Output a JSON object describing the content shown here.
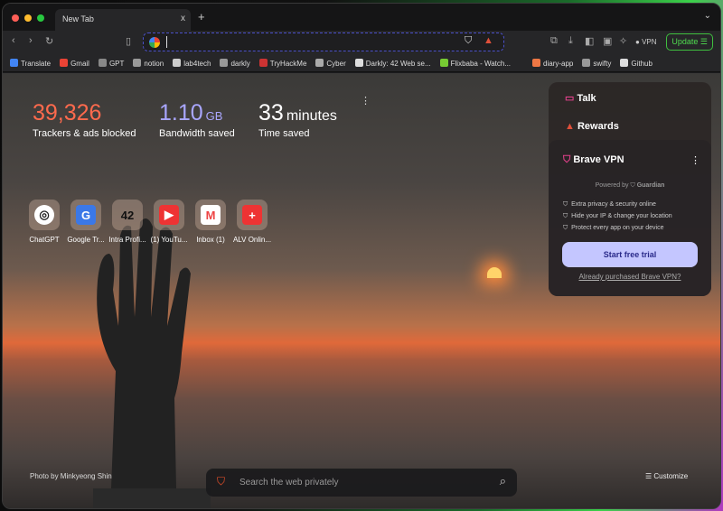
{
  "tab": {
    "title": "New Tab",
    "close": "x",
    "new": "+"
  },
  "toolbar": {
    "vpn": "VPN",
    "update": "Update"
  },
  "bookmarks": [
    "Translate",
    "Gmail",
    "GPT",
    "notion",
    "lab4tech",
    "darkly",
    "TryHackMe",
    "Cyber",
    "Darkly: 42 Web se...",
    "Flixbaba - Watch...",
    "diary-app",
    "swifty",
    "Github"
  ],
  "stats": [
    {
      "value": "39,326",
      "unit": "",
      "label": "Trackers & ads blocked",
      "color": "#ff6a4d"
    },
    {
      "value": "1.10",
      "unit": "GB",
      "label": "Bandwidth saved",
      "color": "#a9a6ff"
    },
    {
      "value": "33",
      "unit": "minutes",
      "label": "Time saved",
      "color": "#ffffff"
    }
  ],
  "tiles": [
    {
      "label": "ChatGPT",
      "glyph": "◎"
    },
    {
      "label": "Google Tr...",
      "glyph": "G"
    },
    {
      "label": "Intra Profi...",
      "glyph": "42"
    },
    {
      "label": "(1) YouTu...",
      "glyph": "▶"
    },
    {
      "label": "Inbox (1)",
      "glyph": "M"
    },
    {
      "label": "ALV Onlin...",
      "glyph": "+"
    }
  ],
  "panel": {
    "talk": "Talk",
    "rewards": "Rewards",
    "vpn_title": "Brave VPN",
    "powered": "Powered by",
    "guardian": "Guardian",
    "features": [
      "Extra privacy & security online",
      "Hide your IP & change your location",
      "Protect every app on your device"
    ],
    "cta": "Start free trial",
    "link": "Already purchased Brave VPN?"
  },
  "photo_credit": "Photo by Minkyeong Shin",
  "search": {
    "placeholder": "Search the web privately"
  },
  "customize": "Customize"
}
